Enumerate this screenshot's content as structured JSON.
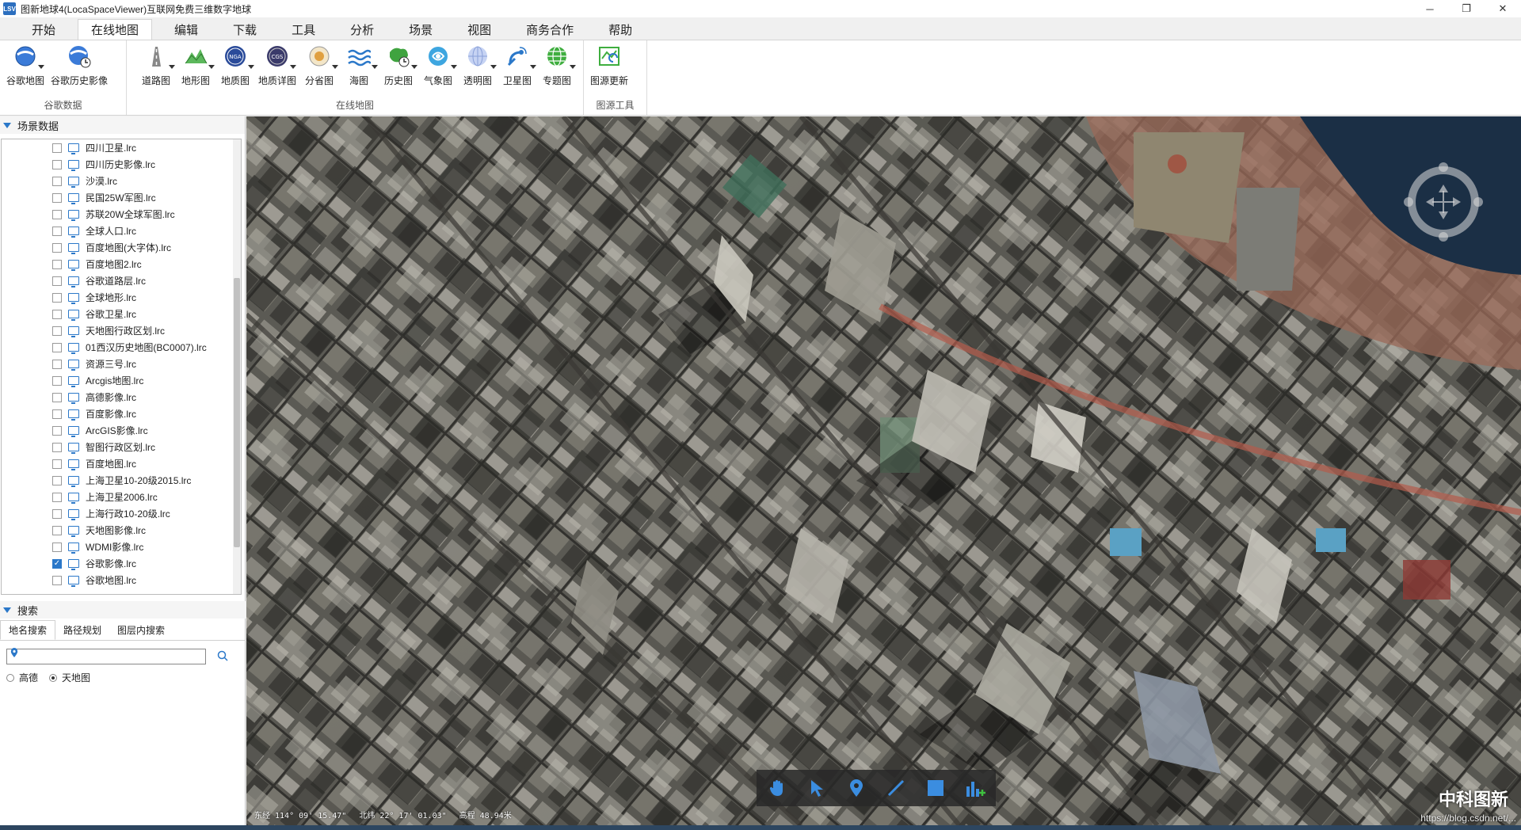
{
  "window": {
    "title": "图新地球4(LocaSpaceViewer)互联网免费三维数字地球",
    "icon_text": "LSV",
    "controls": {
      "minimize": "─",
      "restore": "❐",
      "close": "✕"
    }
  },
  "ribbon_tabs": [
    {
      "label": "开始"
    },
    {
      "label": "在线地图",
      "active": true
    },
    {
      "label": "编辑"
    },
    {
      "label": "下载"
    },
    {
      "label": "工具"
    },
    {
      "label": "分析"
    },
    {
      "label": "场景"
    },
    {
      "label": "视图"
    },
    {
      "label": "商务合作"
    },
    {
      "label": "帮助"
    }
  ],
  "ribbon_groups": [
    {
      "label": "谷歌数据",
      "buttons": [
        {
          "label": "谷歌地图",
          "icon": "google-globe-icon",
          "dropdown": true
        },
        {
          "label": "谷歌历史影像",
          "icon": "google-history-icon",
          "dropdown": false
        }
      ]
    },
    {
      "label": "在线地图",
      "buttons": [
        {
          "label": "道路图",
          "icon": "road-map-icon",
          "dropdown": true
        },
        {
          "label": "地形图",
          "icon": "terrain-map-icon",
          "dropdown": true
        },
        {
          "label": "地质图",
          "icon": "geology-map-icon",
          "dropdown": true
        },
        {
          "label": "地质详图",
          "icon": "geology-detail-icon",
          "dropdown": true
        },
        {
          "label": "分省图",
          "icon": "province-map-icon",
          "dropdown": true
        },
        {
          "label": "海图",
          "icon": "sea-chart-icon",
          "dropdown": true
        },
        {
          "label": "历史图",
          "icon": "history-map-icon",
          "dropdown": true
        },
        {
          "label": "气象图",
          "icon": "weather-map-icon",
          "dropdown": true
        },
        {
          "label": "透明图",
          "icon": "transparent-map-icon",
          "dropdown": true
        },
        {
          "label": "卫星图",
          "icon": "satellite-map-icon",
          "dropdown": true
        },
        {
          "label": "专题图",
          "icon": "thematic-map-icon",
          "dropdown": true
        }
      ]
    },
    {
      "label": "图源工具",
      "buttons": [
        {
          "label": "图源更新",
          "icon": "source-update-icon",
          "dropdown": false
        }
      ]
    }
  ],
  "scene_panel": {
    "title": "场景数据",
    "items": [
      {
        "label": "四川卫星.lrc",
        "checked": false
      },
      {
        "label": "四川历史影像.lrc",
        "checked": false
      },
      {
        "label": "沙漠.lrc",
        "checked": false
      },
      {
        "label": "民国25W军图.lrc",
        "checked": false
      },
      {
        "label": "苏联20W全球军图.lrc",
        "checked": false
      },
      {
        "label": "全球人口.lrc",
        "checked": false
      },
      {
        "label": "百度地图(大字体).lrc",
        "checked": false
      },
      {
        "label": "百度地图2.lrc",
        "checked": false
      },
      {
        "label": "谷歌道路层.lrc",
        "checked": false
      },
      {
        "label": "全球地形.lrc",
        "checked": false
      },
      {
        "label": "谷歌卫星.lrc",
        "checked": false
      },
      {
        "label": "天地图行政区划.lrc",
        "checked": false
      },
      {
        "label": "01西汉历史地图(BC0007).lrc",
        "checked": false
      },
      {
        "label": "资源三号.lrc",
        "checked": false
      },
      {
        "label": "Arcgis地图.lrc",
        "checked": false
      },
      {
        "label": "高德影像.lrc",
        "checked": false
      },
      {
        "label": "百度影像.lrc",
        "checked": false
      },
      {
        "label": "ArcGIS影像.lrc",
        "checked": false
      },
      {
        "label": "智图行政区划.lrc",
        "checked": false
      },
      {
        "label": "百度地图.lrc",
        "checked": false
      },
      {
        "label": "上海卫星10-20级2015.lrc",
        "checked": false
      },
      {
        "label": "上海卫星2006.lrc",
        "checked": false
      },
      {
        "label": "上海行政10-20级.lrc",
        "checked": false
      },
      {
        "label": "天地图影像.lrc",
        "checked": false
      },
      {
        "label": "WDMI影像.lrc",
        "checked": false
      },
      {
        "label": "谷歌影像.lrc",
        "checked": true
      },
      {
        "label": "谷歌地图.lrc",
        "checked": false
      }
    ]
  },
  "search_panel": {
    "title": "搜索",
    "tabs": [
      {
        "label": "地名搜索",
        "active": true
      },
      {
        "label": "路径规划",
        "active": false
      },
      {
        "label": "图层内搜索",
        "active": false
      }
    ],
    "input_value": "",
    "sources": [
      {
        "label": "高德",
        "selected": false
      },
      {
        "label": "天地图",
        "selected": true
      }
    ]
  },
  "map": {
    "coords": {
      "longitude": "东经 114° 09' 15.47\"",
      "latitude": "北纬 22° 17' 01.03\"",
      "elevation": "高程 48.94米"
    },
    "watermark": "中科图新",
    "url_text": "https://blog.csdn.net/...",
    "tools": [
      {
        "name": "pan-tool",
        "icon": "hand-icon"
      },
      {
        "name": "select-tool",
        "icon": "cursor-icon"
      },
      {
        "name": "placemark-tool",
        "icon": "pin-icon"
      },
      {
        "name": "line-tool",
        "icon": "line-icon"
      },
      {
        "name": "polygon-tool",
        "icon": "square-icon"
      },
      {
        "name": "chart-tool",
        "icon": "chart-add-icon"
      }
    ]
  },
  "colors": {
    "accent": "#2b78c9",
    "toolbar_bg": "#282828",
    "status_bar": "#2d4660"
  }
}
